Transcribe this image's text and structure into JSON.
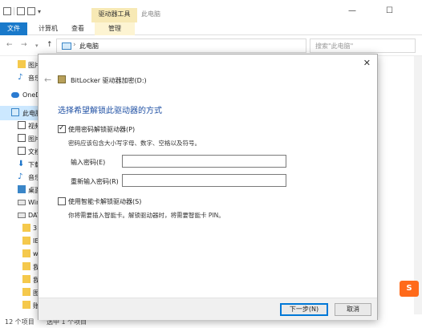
{
  "titlebar": {
    "tools_tab": "驱动器工具",
    "window_title": "此电脑",
    "minimize": "—",
    "maximize": "☐",
    "close": "✕"
  },
  "ribbon": {
    "tabs": [
      {
        "label": "文件"
      },
      {
        "label": "计算机"
      },
      {
        "label": "查看"
      },
      {
        "label": "管理"
      }
    ]
  },
  "navbar": {
    "back": "←",
    "forward": "→",
    "up": "↑",
    "path": "此电脑",
    "path_sep": "›",
    "search_placeholder": "搜索\"此电脑\""
  },
  "navpane": {
    "items": [
      {
        "label": "图片",
        "icon": "folder-icon"
      },
      {
        "label": "音乐",
        "icon": "music-icon"
      },
      {
        "label": "OneDrive",
        "icon": "cloud-icon"
      },
      {
        "label": "此电脑",
        "icon": "computer-icon"
      },
      {
        "label": "视频",
        "icon": "video-icon"
      },
      {
        "label": "图片",
        "icon": "picture-icon"
      },
      {
        "label": "文档",
        "icon": "document-icon"
      },
      {
        "label": "下载",
        "icon": "download-icon"
      },
      {
        "label": "音乐",
        "icon": "music-icon"
      },
      {
        "label": "桌面",
        "icon": "desktop-icon"
      },
      {
        "label": "Windows",
        "icon": "drive-icon"
      },
      {
        "label": "DATA",
        "icon": "drive-icon"
      },
      {
        "label": "3",
        "icon": "folder-icon"
      },
      {
        "label": "IE",
        "icon": "folder-icon"
      },
      {
        "label": "w",
        "icon": "folder-icon"
      },
      {
        "label": "我",
        "icon": "folder-icon"
      },
      {
        "label": "我",
        "icon": "folder-icon"
      },
      {
        "label": "图",
        "icon": "folder-icon"
      },
      {
        "label": "账",
        "icon": "folder-icon"
      }
    ]
  },
  "statusbar": {
    "count": "12 个项目",
    "selected": "选中 1 个项目"
  },
  "dialog": {
    "title": "BitLocker 驱动器加密(D:)",
    "close": "✕",
    "back": "←",
    "heading": "选择希望解锁此驱动器的方式",
    "password_option": {
      "label": "使用密码解锁驱动器(P)",
      "checked": true,
      "hint": "密码应该包含大小写字母、数字、空格以及符号。",
      "enter_label": "输入密码(E)",
      "enter_value": "",
      "reenter_label": "重新输入密码(R)",
      "reenter_value": ""
    },
    "smartcard_option": {
      "label": "使用智能卡解锁驱动器(S)",
      "checked": false,
      "hint": "你将需要插入智能卡。解锁驱动器时，将需要智能卡 PIN。"
    },
    "buttons": {
      "next": "下一步(N)",
      "cancel": "取消"
    }
  },
  "colors": {
    "file_tab": "#1979ca",
    "tools_tab": "#f7e9b5",
    "heading": "#1e4fa3",
    "default_button_border": "#0078d7"
  }
}
